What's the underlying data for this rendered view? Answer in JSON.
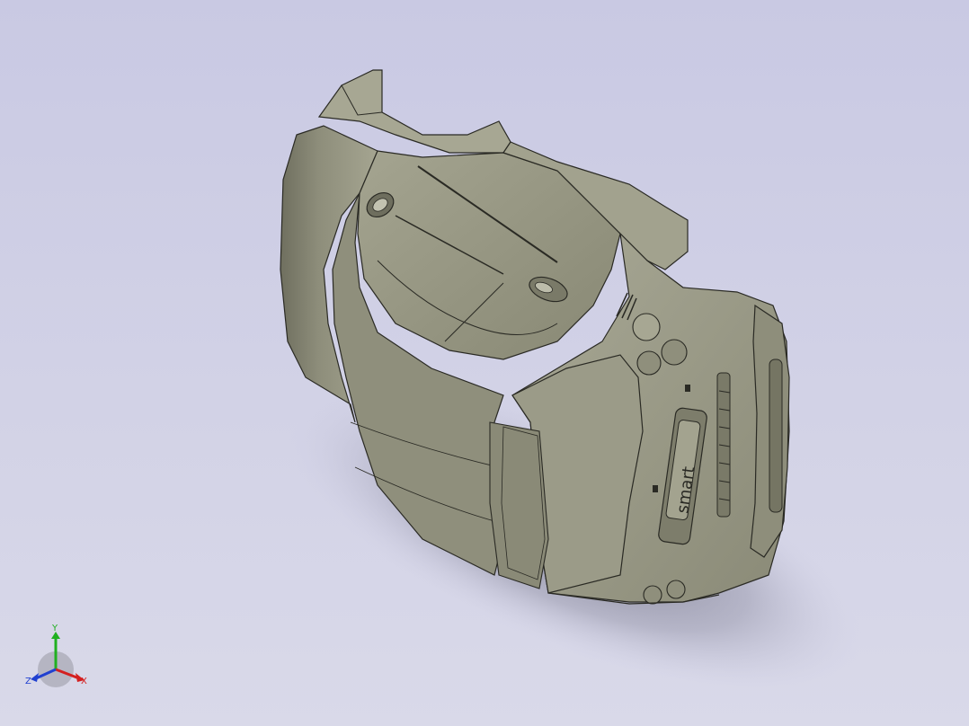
{
  "viewport": {
    "background_top": "#c9c9e3",
    "background_bottom": "#d9d9e9"
  },
  "model": {
    "badge_text": "smart",
    "body_color": "#9a9a86",
    "edge_color": "#2a2a24"
  },
  "triad": {
    "x_label": "X",
    "y_label": "Y",
    "z_label": "Z",
    "x_color": "#d42020",
    "y_color": "#20b020",
    "z_color": "#2040d0"
  }
}
